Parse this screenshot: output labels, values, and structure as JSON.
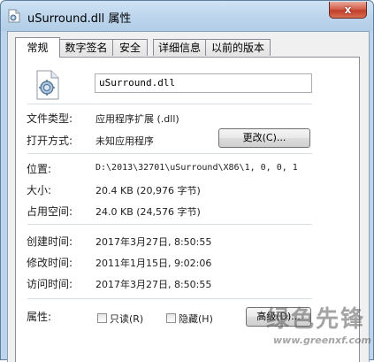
{
  "window": {
    "title": "uSurround.dll 属性",
    "close_label": "x"
  },
  "tabs": [
    {
      "label": "常规",
      "active": true
    },
    {
      "label": "数字签名",
      "active": false
    },
    {
      "label": "安全",
      "active": false
    },
    {
      "label": "详细信息",
      "active": false
    },
    {
      "label": "以前的版本",
      "active": false
    }
  ],
  "general": {
    "file_icon": "dll-file-icon",
    "filename": "uSurround.dll",
    "file_type_label": "文件类型:",
    "file_type_value": "应用程序扩展 (.dll)",
    "open_with_label": "打开方式:",
    "open_with_value": "未知应用程序",
    "change_button": "更改(C)...",
    "location_label": "位置:",
    "location_value": "D:\\2013\\32701\\uSurround\\X86\\1, 0, 0, 1",
    "size_label": "大小:",
    "size_value": "20.4 KB (20,976 字节)",
    "size_on_disk_label": "占用空间:",
    "size_on_disk_value": "24.0 KB (24,576 字节)",
    "created_label": "创建时间:",
    "created_value": "2017年3月27日, 8:50:55",
    "modified_label": "修改时间:",
    "modified_value": "2011年1月15日, 9:02:06",
    "accessed_label": "访问时间:",
    "accessed_value": "2017年3月27日, 8:50:55",
    "attributes_label": "属性:",
    "readonly_label": "只读(R)",
    "readonly_checked": false,
    "hidden_label": "隐藏(H)",
    "hidden_checked": false,
    "advanced_button": "高级(D)..."
  },
  "watermark": {
    "text": "绿色先锋",
    "url": "www.greenxf.com"
  },
  "colors": {
    "titlebar": "#bcd5ec",
    "close_button": "#c75050",
    "panel_bg": "#ffffff",
    "dialog_bg": "#f0f0f0"
  }
}
